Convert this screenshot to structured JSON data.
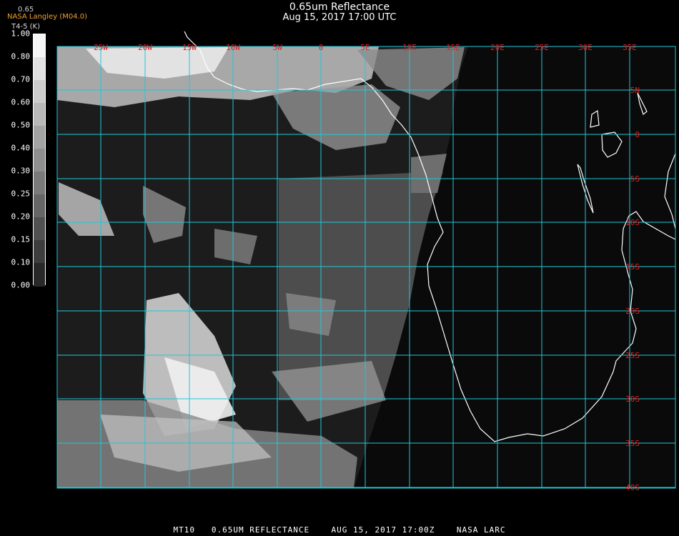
{
  "header": {
    "title": "0.65um Reflectance",
    "datetime": "Aug 15, 2017 17:00 UTC",
    "producer": "NASA Langley (M04.0)",
    "colorbar_name": "T4-5 (K)",
    "colorbar_top_label": "0.65"
  },
  "colorbar": {
    "ticks": [
      "1.00",
      "0.80",
      "0.70",
      "0.60",
      "0.50",
      "0.40",
      "0.30",
      "0.25",
      "0.20",
      "0.15",
      "0.10",
      "0.00"
    ]
  },
  "map": {
    "lon_labels": [
      "25W",
      "20W",
      "15W",
      "10W",
      "5W",
      "0",
      "5E",
      "10E",
      "15E",
      "20E",
      "25E",
      "30E",
      "35E"
    ],
    "lat_labels": [
      "5N",
      "0",
      "5S",
      "10S",
      "15S",
      "20S",
      "25S",
      "30S",
      "35S",
      "40S"
    ],
    "colors": {
      "grid": "#20c8d8",
      "labels": "#e02020",
      "coast": "#ffffff",
      "background": "#0a0a0a"
    }
  },
  "footer": "MT10   0.65UM REFLECTANCE    AUG 15, 2017 17:00Z    NASA LARC"
}
